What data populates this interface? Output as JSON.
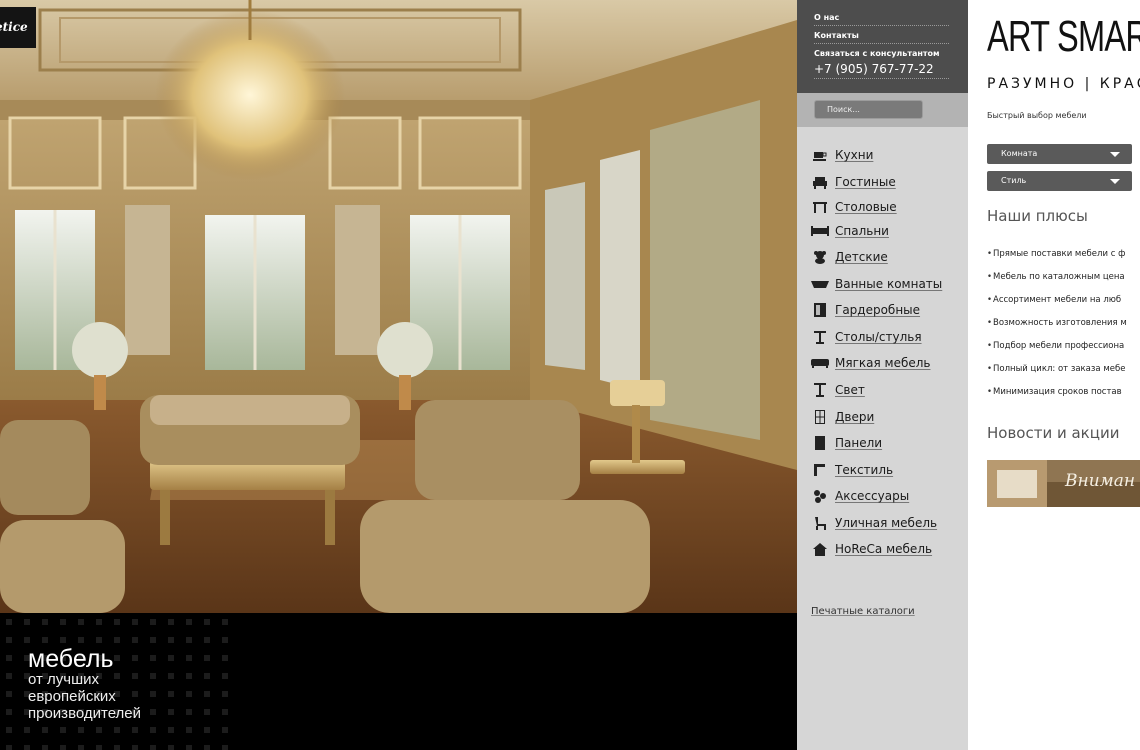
{
  "logo": {
    "text": "etice"
  },
  "tagline": {
    "main": "мебель",
    "lines": [
      "от лучших",
      "европейских",
      "производителей"
    ]
  },
  "top_links": {
    "about": "О нас",
    "contacts": "Контакты",
    "consultant": "Связаться с консультантом",
    "phone": "+7 (905) 767-77-22"
  },
  "search": {
    "placeholder": "Поиск..."
  },
  "categories": [
    {
      "label": "Кухни",
      "icon": "cup-icon"
    },
    {
      "label": "Гостиные",
      "icon": "armchair-icon"
    },
    {
      "label": "Столовые",
      "icon": "table-icon"
    },
    {
      "label": "Спальни",
      "icon": "bed-icon"
    },
    {
      "label": "Детские",
      "icon": "teddy-bear-icon"
    },
    {
      "label": "Ванные комнаты",
      "icon": "bathtub-icon"
    },
    {
      "label": "Гардеробные",
      "icon": "wardrobe-icon"
    },
    {
      "label": "Столы/стулья",
      "icon": "side-table-icon"
    },
    {
      "label": "Мягкая мебель",
      "icon": "sofa-icon"
    },
    {
      "label": "Свет",
      "icon": "lamp-icon"
    },
    {
      "label": "Двери",
      "icon": "door-icon"
    },
    {
      "label": "Панели",
      "icon": "panel-icon"
    },
    {
      "label": "Текстиль",
      "icon": "textile-icon"
    },
    {
      "label": "Аксессуары",
      "icon": "accessories-icon"
    },
    {
      "label": "Уличная мебель",
      "icon": "outdoor-chair-icon"
    },
    {
      "label": "HoReCa мебель",
      "icon": "house-icon"
    }
  ],
  "catalogs_link": "Печатные каталоги",
  "brand": {
    "title": "ART SMAR",
    "subtitle": "РАЗУМНО | КРАС"
  },
  "quick_select": {
    "label": "Быстрый выбор мебели",
    "room": "Комната",
    "style": "Стиль"
  },
  "advantages": {
    "heading": "Наши плюсы",
    "items": [
      "Прямые поставки мебели с ф",
      "Мебель по каталожным цена",
      "Ассортимент  мебели на люб",
      "Возможность изготовления м",
      "Подбор мебели профессиона",
      "Полный цикл: от заказа мебе",
      "Минимизация сроков постав"
    ]
  },
  "news": {
    "heading": "Новости и акции",
    "banner_text": "Вниман"
  },
  "colors": {
    "menu_bg": "#d6d6d6",
    "contact_bg": "#4d4d4d",
    "select_bg": "#5a5a5a",
    "tagline_bg": "#000000"
  }
}
